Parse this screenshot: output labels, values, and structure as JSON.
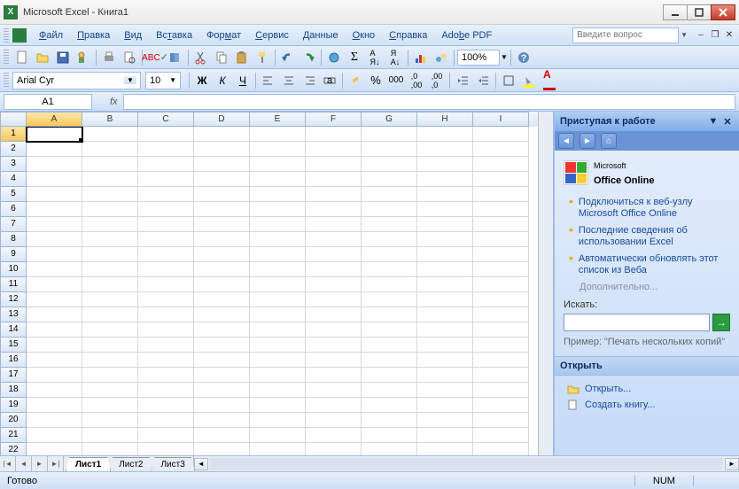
{
  "titlebar": {
    "title": "Microsoft Excel - Книга1"
  },
  "menubar": {
    "items": [
      {
        "label": "Файл",
        "u": 0
      },
      {
        "label": "Правка",
        "u": 0
      },
      {
        "label": "Вид",
        "u": 0
      },
      {
        "label": "Вставка",
        "u": 2
      },
      {
        "label": "Формат",
        "u": 3
      },
      {
        "label": "Сервис",
        "u": 0
      },
      {
        "label": "Данные",
        "u": 0
      },
      {
        "label": "Окно",
        "u": 0
      },
      {
        "label": "Справка",
        "u": 0
      },
      {
        "label": "Adobe PDF",
        "u": 3
      }
    ],
    "help_placeholder": "Введите вопрос"
  },
  "toolbar": {
    "zoom": "100%"
  },
  "fmtbar": {
    "font": "Arial Cyr",
    "size": "10"
  },
  "nameBox": "A1",
  "formula": "",
  "columns": [
    "A",
    "B",
    "C",
    "D",
    "E",
    "F",
    "G",
    "H",
    "I"
  ],
  "rows": [
    1,
    2,
    3,
    4,
    5,
    6,
    7,
    8,
    9,
    10,
    11,
    12,
    13,
    14,
    15,
    16,
    17,
    18,
    19,
    20,
    21,
    22
  ],
  "activeCell": {
    "row": 1,
    "col": "A"
  },
  "sheetTabs": [
    "Лист1",
    "Лист2",
    "Лист3"
  ],
  "activeSheet": 0,
  "taskpane": {
    "title": "Приступая к работе",
    "office_online": "Office Online",
    "office_online_prefix": "Microsoft",
    "links": [
      "Подключиться к веб-узлу Microsoft Office Online",
      "Последние сведения об использовании Excel",
      "Автоматически обновлять этот список из Веба"
    ],
    "more": "Дополнительно...",
    "search_label": "Искать:",
    "example_label": "Пример:",
    "example_text": "\"Печать нескольких копий\"",
    "open_section": "Открыть",
    "open_link": "Открыть...",
    "create_link": "Создать книгу..."
  },
  "statusbar": {
    "ready": "Готово",
    "num": "NUM"
  }
}
